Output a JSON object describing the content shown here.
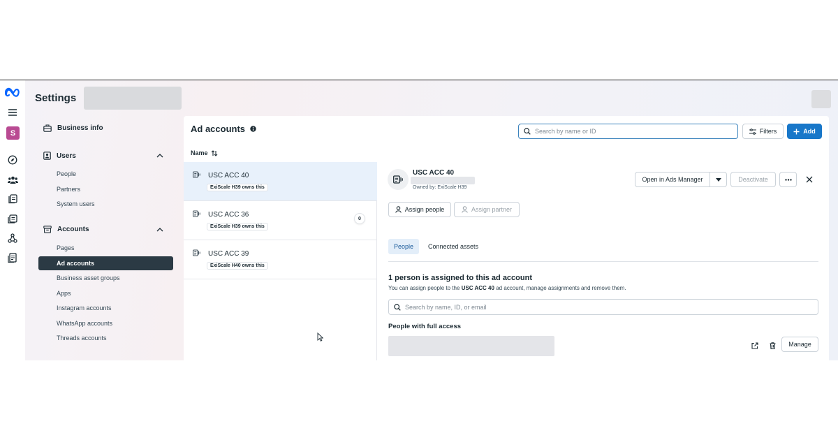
{
  "app": {
    "title": "Settings",
    "avatar_letter": "S",
    "brand_color": "#0866ff",
    "rail_icons": [
      "meta-logo-icon",
      "menu-icon",
      "compass-icon",
      "people-icon",
      "pages-icon",
      "settings-list-icon",
      "network-icon",
      "billing-icon"
    ]
  },
  "sidebar": {
    "business_info": "Business info",
    "users": {
      "label": "Users",
      "items": [
        "People",
        "Partners",
        "System users"
      ]
    },
    "accounts": {
      "label": "Accounts",
      "items": [
        "Pages",
        "Ad accounts",
        "Business asset groups",
        "Apps",
        "Instagram accounts",
        "WhatsApp accounts",
        "Threads accounts"
      ],
      "active": "Ad accounts"
    }
  },
  "main": {
    "title": "Ad accounts",
    "search_placeholder": "Search by name or ID",
    "filters_label": "Filters",
    "add_label": "Add",
    "column_header": "Name"
  },
  "accounts_list": [
    {
      "name": "USC ACC 40",
      "owner_badge": "ExiScale H39 owns this",
      "selected": true,
      "count": null
    },
    {
      "name": "USC ACC 36",
      "owner_badge": "ExiScale H39 owns this",
      "selected": false,
      "count": "0"
    },
    {
      "name": "USC ACC 39",
      "owner_badge": "ExiScale H40 owns this",
      "selected": false,
      "count": null
    }
  ],
  "detail": {
    "name": "USC ACC 40",
    "owner": "Owned by: ExiScale H39",
    "open_ads_manager": "Open in Ads Manager",
    "deactivate": "Deactivate",
    "assign_people": "Assign people",
    "assign_partner": "Assign partner",
    "tabs": [
      "People",
      "Connected assets"
    ],
    "active_tab": "People",
    "assign_title": "1 person is assigned to this ad account",
    "assign_desc_prefix": "You can assign people to the",
    "assign_desc_account": "USC ACC 40",
    "assign_desc_suffix": "ad account, manage assignments and remove them.",
    "people_search_placeholder": "Search by name, ID, or email",
    "full_access_heading": "People with full access",
    "manage_label": "Manage"
  }
}
